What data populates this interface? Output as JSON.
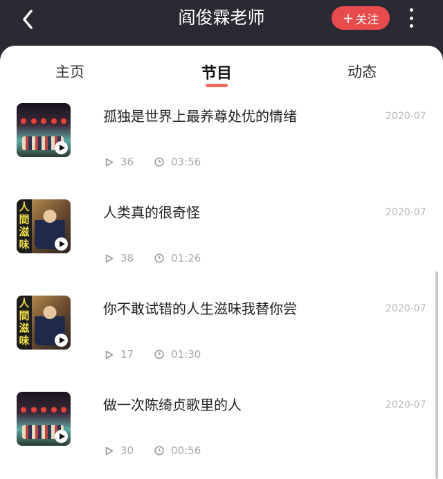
{
  "header": {
    "title": "阎俊霖老师",
    "follow_plus": "+",
    "follow_label": "关注",
    "back_icon": "chevron-left-icon",
    "more_icon": "more-vertical-icon"
  },
  "tabs": [
    {
      "label": "主页",
      "active": false
    },
    {
      "label": "节目",
      "active": true
    },
    {
      "label": "动态",
      "active": false
    }
  ],
  "colors": {
    "accent": "#e84b4b",
    "header_bg": "#2b2a33",
    "tab_indicator": "#ee6a5c"
  },
  "programs": [
    {
      "title": "孤独是世界上最养尊处优的情绪",
      "date": "2020-07",
      "plays": "36",
      "duration": "03:56",
      "thumbnail": "stage-performance"
    },
    {
      "title": "人类真的很奇怪",
      "date": "2020-07",
      "plays": "38",
      "duration": "01:26",
      "thumbnail": "poster",
      "thumbnail_text": "人間滋味"
    },
    {
      "title": "你不敢试错的人生滋味我替你尝",
      "date": "2020-07",
      "plays": "17",
      "duration": "01:30",
      "thumbnail": "poster",
      "thumbnail_text": "人間滋味"
    },
    {
      "title": "做一次陈绮贞歌里的人",
      "date": "2020-07",
      "plays": "30",
      "duration": "00:56",
      "thumbnail": "stage-performance"
    }
  ]
}
